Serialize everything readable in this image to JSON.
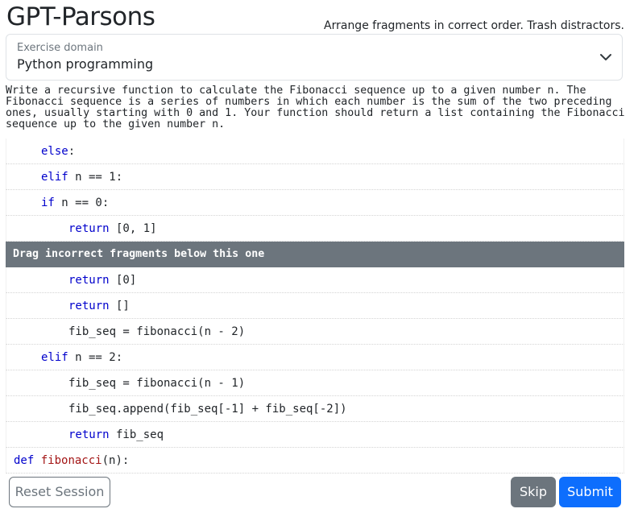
{
  "header": {
    "title": "GPT-Parsons",
    "subtitle": "Arrange fragments in correct order. Trash distractors."
  },
  "domain_select": {
    "label": "Exercise domain",
    "value": "Python programming",
    "icon": "chevron-down-icon"
  },
  "problem": {
    "text": "Write a recursive function to calculate the Fibonacci sequence up to a given number n. The Fibonacci sequence is a series of numbers in which each number is the sum of the two preceding ones, usually starting with 0 and 1. Your function should return a list containing the Fibonacci sequence up to the given number n."
  },
  "fragments_above": [
    {
      "indent": 1,
      "tokens": [
        {
          "t": "else",
          "c": "kw"
        },
        {
          "t": ":",
          "c": ""
        }
      ]
    },
    {
      "indent": 1,
      "tokens": [
        {
          "t": "elif",
          "c": "kw"
        },
        {
          "t": " n == 1:",
          "c": ""
        }
      ]
    },
    {
      "indent": 1,
      "tokens": [
        {
          "t": "if",
          "c": "kw"
        },
        {
          "t": " n == 0:",
          "c": ""
        }
      ]
    },
    {
      "indent": 2,
      "tokens": [
        {
          "t": "return",
          "c": "kw"
        },
        {
          "t": " [0, 1]",
          "c": ""
        }
      ]
    }
  ],
  "divider_label": "Drag incorrect fragments below this one",
  "fragments_below": [
    {
      "indent": 2,
      "tokens": [
        {
          "t": "return",
          "c": "kw"
        },
        {
          "t": " [0]",
          "c": ""
        }
      ]
    },
    {
      "indent": 2,
      "tokens": [
        {
          "t": "return",
          "c": "kw"
        },
        {
          "t": " []",
          "c": ""
        }
      ]
    },
    {
      "indent": 2,
      "tokens": [
        {
          "t": "fib_seq = fibonacci(n - 2)",
          "c": ""
        }
      ]
    },
    {
      "indent": 1,
      "tokens": [
        {
          "t": "elif",
          "c": "kw"
        },
        {
          "t": " n == 2:",
          "c": ""
        }
      ]
    },
    {
      "indent": 2,
      "tokens": [
        {
          "t": "fib_seq = fibonacci(n - 1)",
          "c": ""
        }
      ]
    },
    {
      "indent": 2,
      "tokens": [
        {
          "t": "fib_seq.append(fib_seq[-1] + fib_seq[-2])",
          "c": ""
        }
      ]
    },
    {
      "indent": 2,
      "tokens": [
        {
          "t": "return",
          "c": "kw"
        },
        {
          "t": " fib_seq",
          "c": ""
        }
      ]
    },
    {
      "indent": 0,
      "tokens": [
        {
          "t": "def",
          "c": "kw"
        },
        {
          "t": " ",
          "c": ""
        },
        {
          "t": "fibonacci",
          "c": "fn"
        },
        {
          "t": "(n):",
          "c": ""
        }
      ]
    }
  ],
  "buttons": {
    "reset": "Reset Session",
    "skip": "Skip",
    "submit": "Submit"
  }
}
